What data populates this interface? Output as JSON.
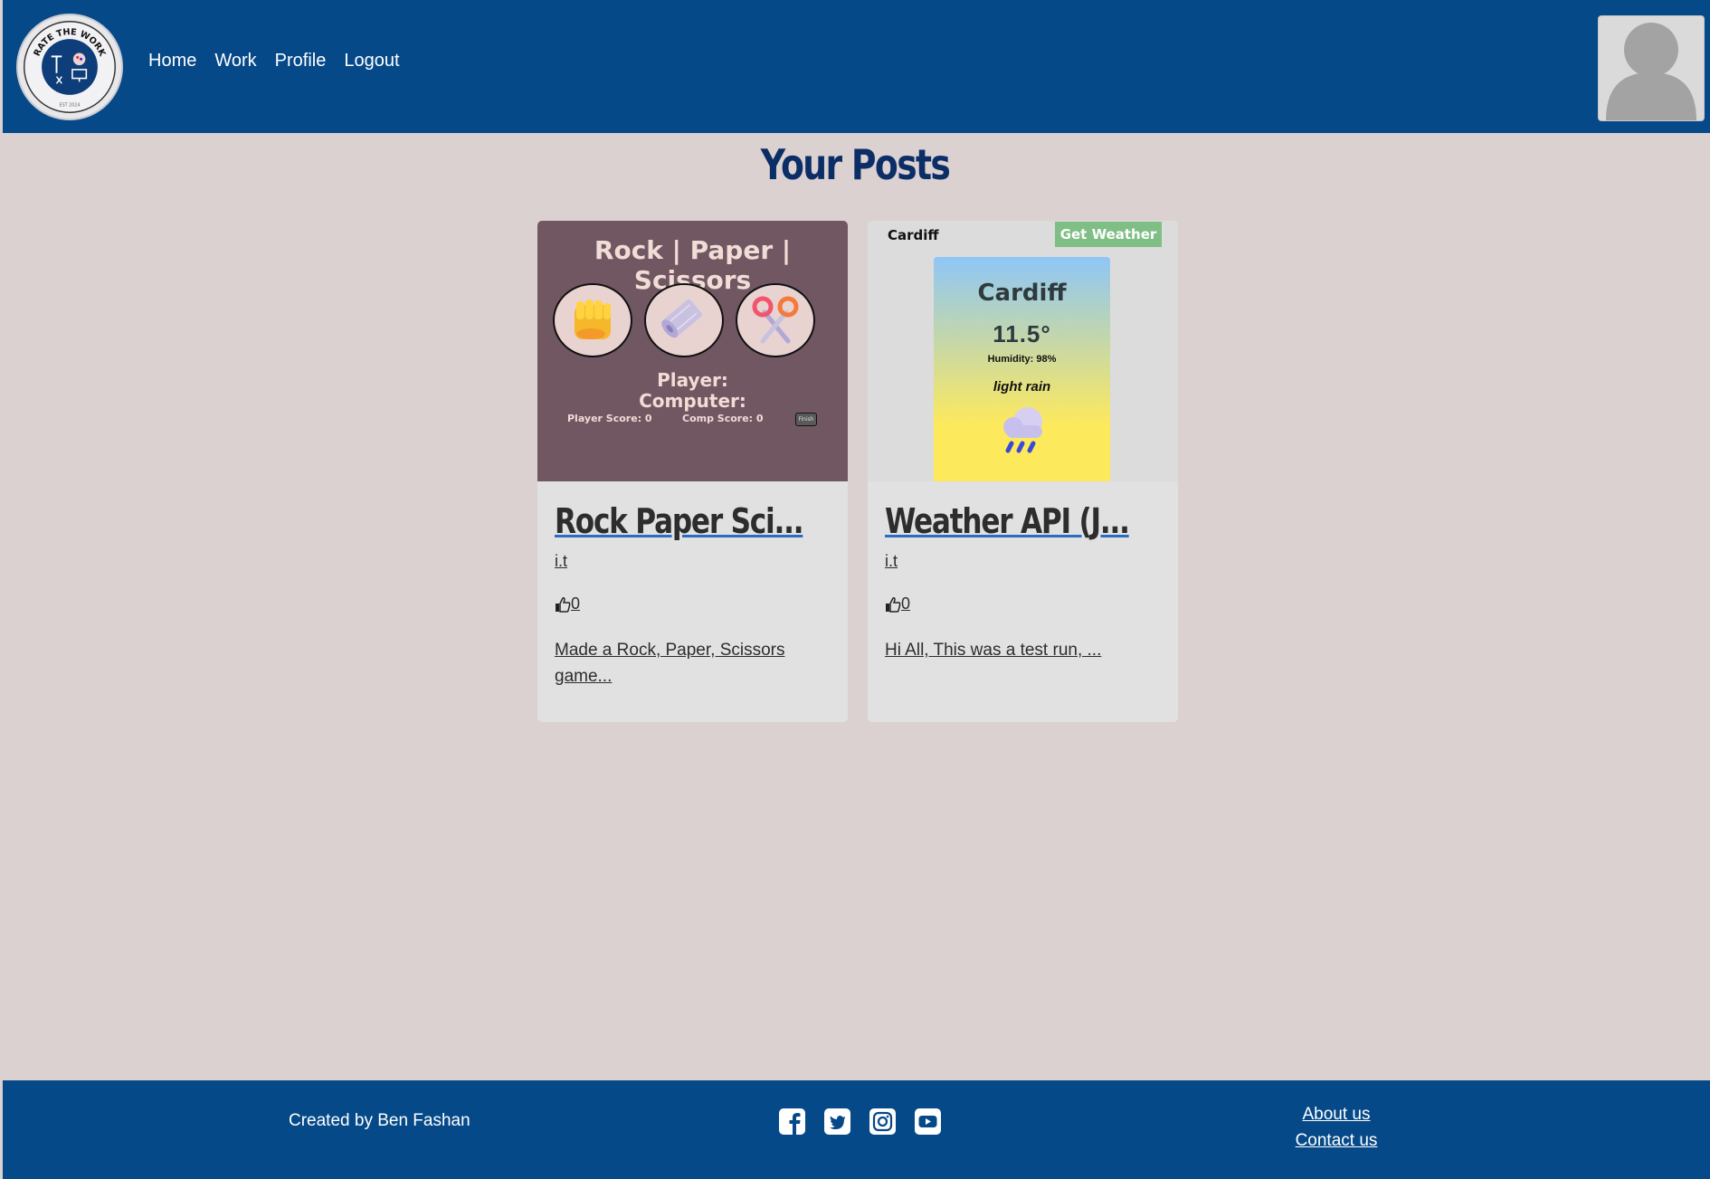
{
  "header": {
    "logo_text": "RATE THE WORK",
    "logo_est": "EST 2024",
    "nav": [
      "Home",
      "Work",
      "Profile",
      "Logout"
    ]
  },
  "page_title": "Your Posts",
  "posts": [
    {
      "title": "Rock Paper Sci...",
      "author": "i.t",
      "likes": "0",
      "description": "Made a Rock, Paper, Scissors game...",
      "thumbnail": {
        "heading": "Rock | Paper | Scissors",
        "choices": [
          "fist-icon",
          "paper-roll-icon",
          "scissors-icon"
        ],
        "player_label": "Player:",
        "computer_label": "Computer:",
        "player_score": "Player Score: 0",
        "comp_score": "Comp Score: 0",
        "finish_button": "Finish"
      }
    },
    {
      "title": "Weather API (J...",
      "author": "i.t",
      "likes": "0",
      "description": "Hi All, This was a test run, ...",
      "thumbnail": {
        "city_input_value": "Cardiff",
        "button": "Get Weather",
        "city": "Cardiff",
        "temperature": "11.5°",
        "humidity": "Humidity: 98%",
        "condition": "light rain",
        "icon": "rain-cloud-icon"
      }
    }
  ],
  "footer": {
    "credit": "Created by Ben Fashan",
    "social": [
      "facebook-icon",
      "twitter-icon",
      "instagram-icon",
      "youtube-icon"
    ],
    "links": [
      "About us",
      "Contact us"
    ]
  },
  "colors": {
    "header_bg": "#064988",
    "page_bg": "#dbd1d1",
    "title": "#0c2e66",
    "card_bg": "#e1e1e1",
    "rps_bg": "#705762",
    "weather_button": "#7fbe84"
  }
}
